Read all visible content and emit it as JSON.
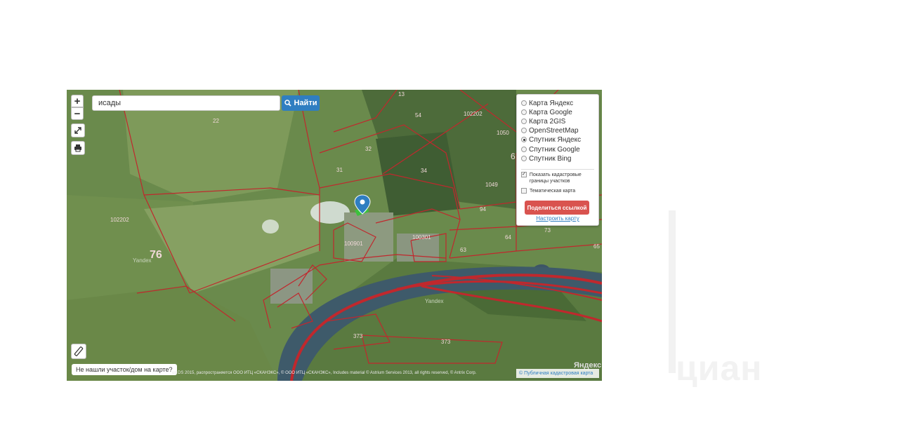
{
  "map": {
    "search": {
      "value": "исады"
    },
    "find_button": "Найти",
    "zoom_in": "+",
    "zoom_out": "−",
    "layers": [
      {
        "label": "Карта Яндекс",
        "selected": false
      },
      {
        "label": "Карта Google",
        "selected": false
      },
      {
        "label": "Карта 2GIS",
        "selected": false
      },
      {
        "label": "OpenStreetMap",
        "selected": false
      },
      {
        "label": "Спутник Яндекс",
        "selected": true
      },
      {
        "label": "Спутник Google",
        "selected": false
      },
      {
        "label": "Спутник Bing",
        "selected": false
      }
    ],
    "show_cadastral": {
      "label": "Показать кадастровые границы участков",
      "checked": true
    },
    "thematic_map": {
      "label": "Тематическая карта",
      "checked": false
    },
    "share_button": "Поделиться ссылкой",
    "setup_link": "Настроить карту",
    "not_found": "Не нашли участок/дом на карте?",
    "attribution": "us DS 2015, распространяется ООО ИТЦ «СКАНЭКС», © ООО ИТЦ «СКАНЭКС», Includes material © Astrium Services 2013, all rights reserved, © Antrix Corp.",
    "yandex_logo": "Яндекс",
    "pkk_link": "Публичная кадастровая карта",
    "watermarks": [
      "Yandex",
      "Yandex"
    ],
    "parcel_labels": [
      "22",
      "54",
      "102202",
      "1050",
      "32",
      "31",
      "34",
      "102202",
      "94",
      "1049",
      "100901",
      "100301",
      "63",
      "64",
      "73",
      "65",
      "76",
      "373",
      "373",
      "13",
      "6"
    ],
    "colors": {
      "parcel_line": "#c0282d",
      "button_blue": "#2f7ec1",
      "share_red": "#d9534f",
      "marker": "#2f7ec1"
    }
  },
  "watermark": "циан"
}
